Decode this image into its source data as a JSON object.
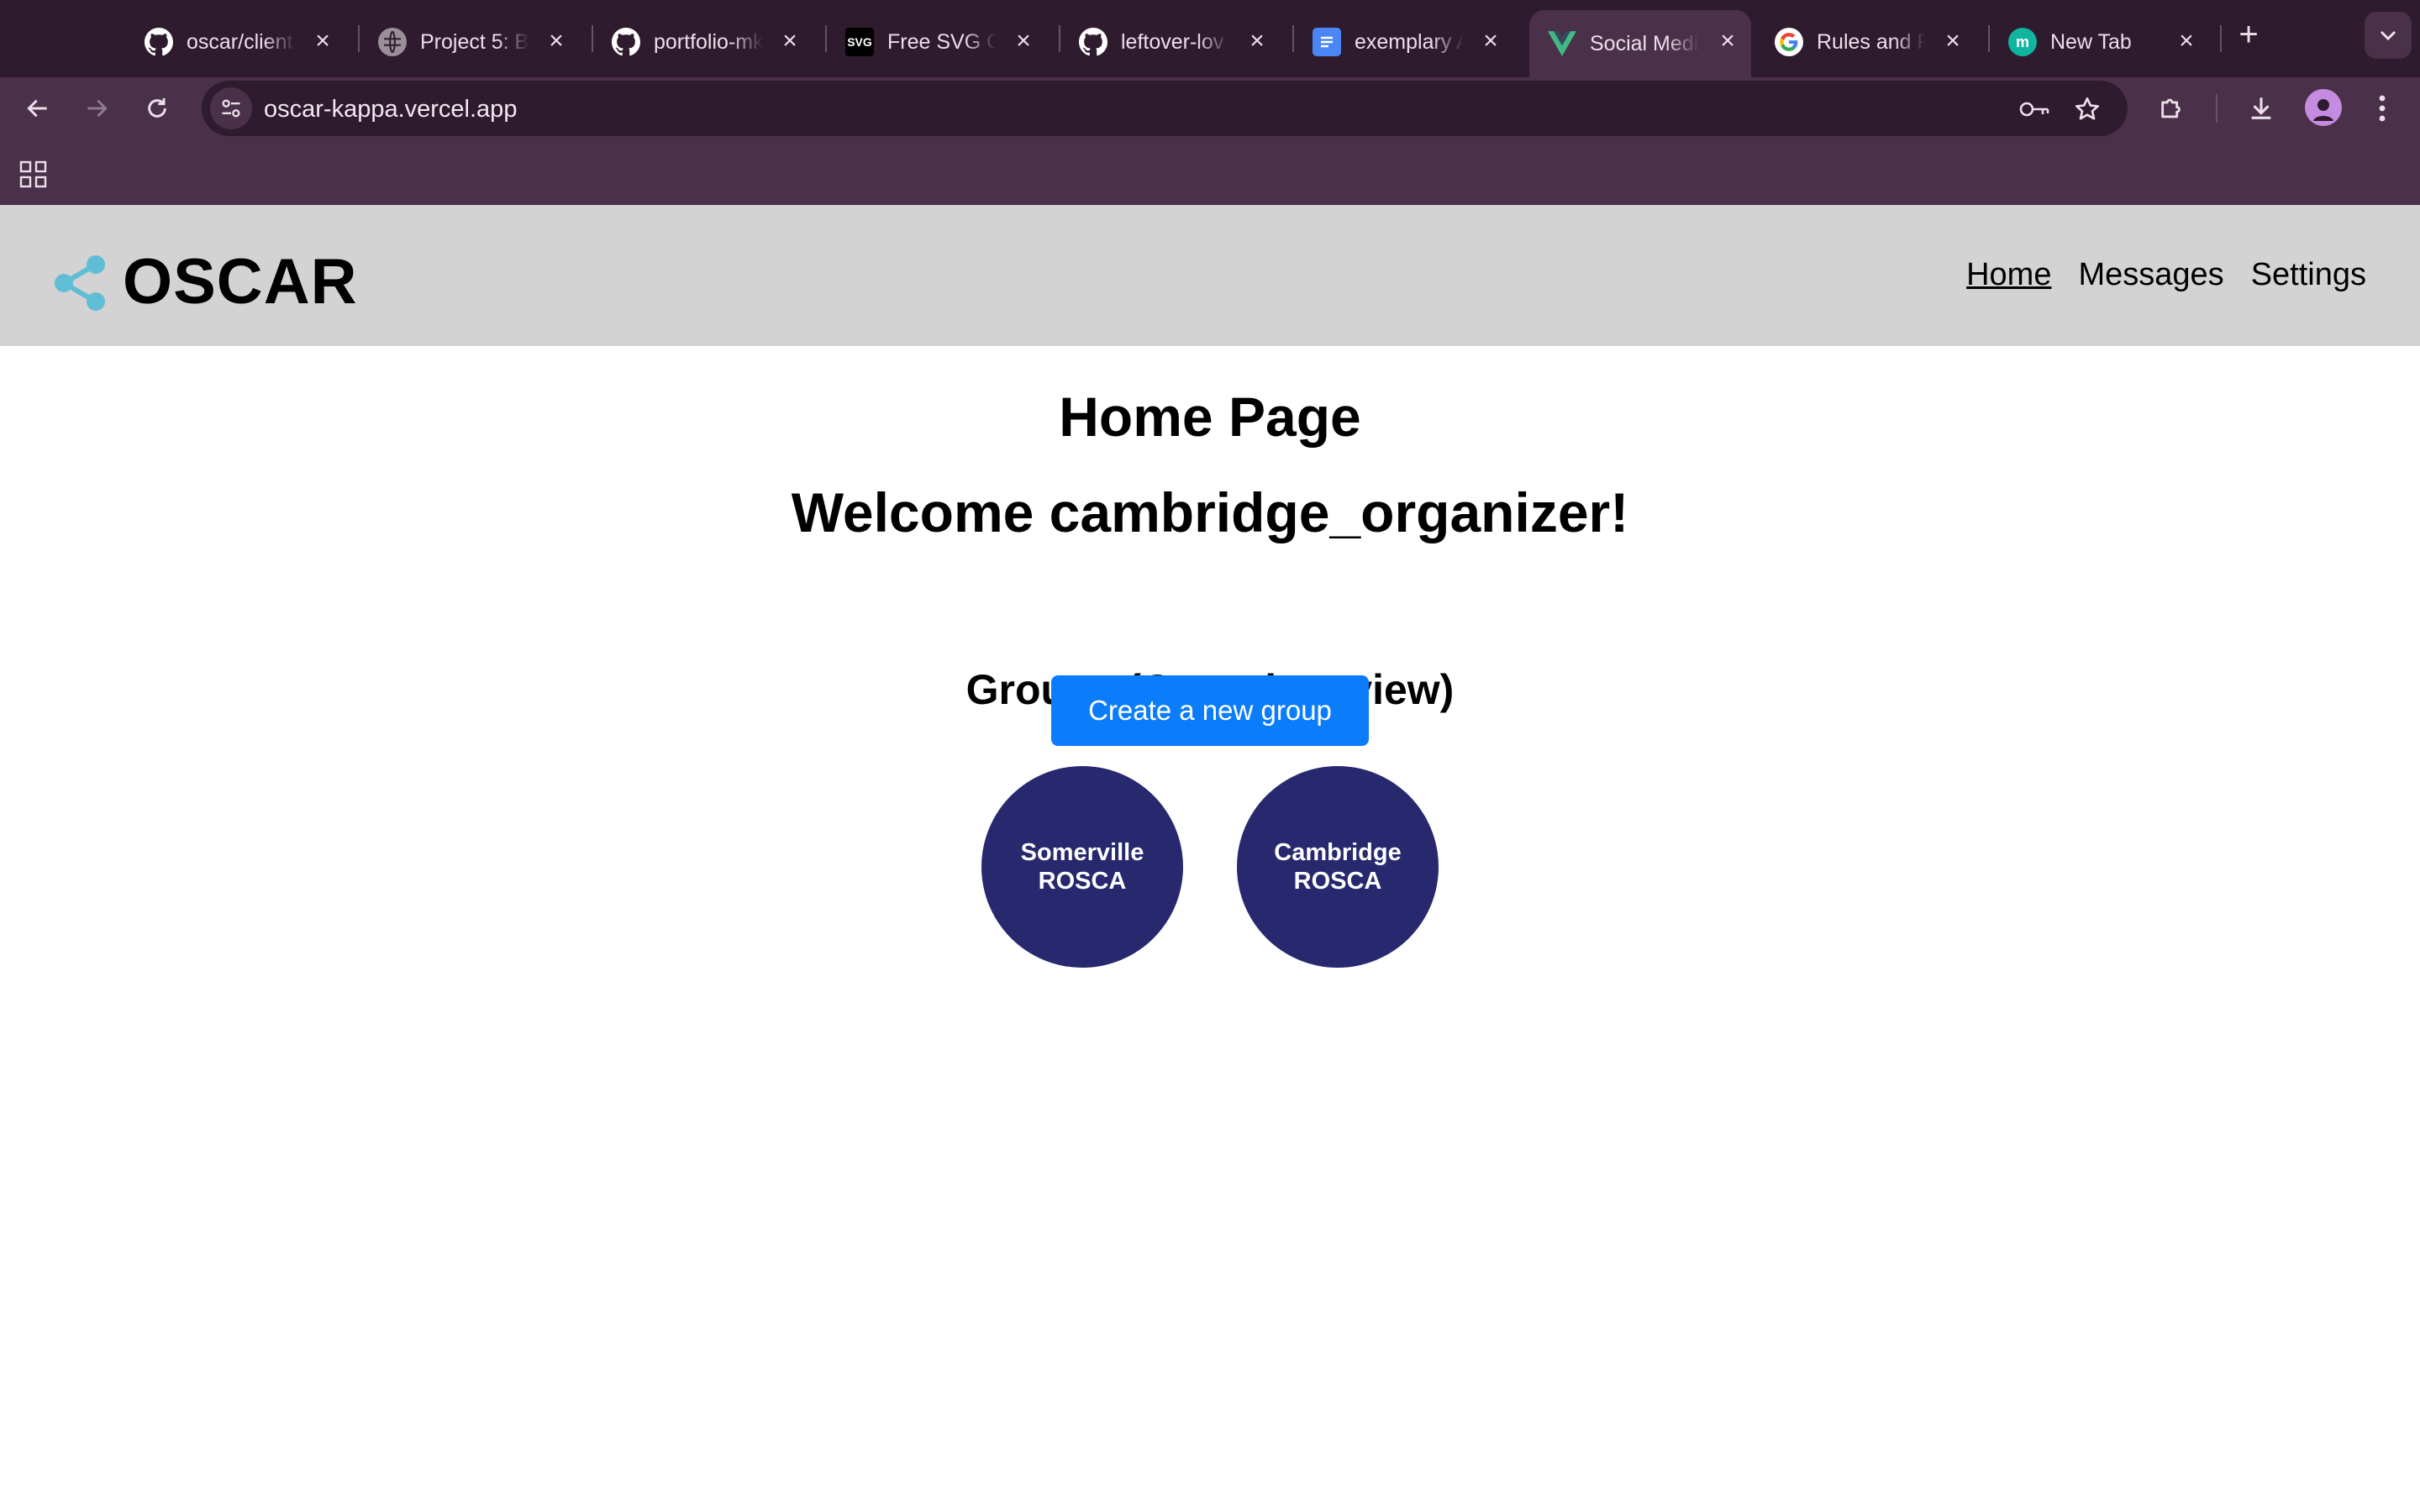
{
  "browser": {
    "tabs": [
      {
        "title": "oscar/client",
        "icon": "github-icon",
        "active": false
      },
      {
        "title": "Project 5: Bu",
        "icon": "globe-icon",
        "active": false
      },
      {
        "title": "portfolio-mk",
        "icon": "github-icon",
        "active": false
      },
      {
        "title": "Free SVG Co",
        "icon": "svg-icon",
        "active": false
      },
      {
        "title": "leftover-lov",
        "icon": "github-icon",
        "active": false
      },
      {
        "title": "exemplary A",
        "icon": "docs-icon",
        "active": false
      },
      {
        "title": "Social Medi",
        "icon": "vue-icon",
        "active": true
      },
      {
        "title": "Rules and R",
        "icon": "google-icon",
        "active": false
      },
      {
        "title": "New Tab",
        "icon": "m-icon",
        "active": false
      }
    ],
    "url": "oscar-kappa.vercel.app"
  },
  "site": {
    "brand": "OSCAR",
    "nav": [
      {
        "label": "Home",
        "current": true
      },
      {
        "label": "Messages",
        "current": false
      },
      {
        "label": "Settings",
        "current": false
      }
    ]
  },
  "page": {
    "title": "Home Page",
    "welcome": "Welcome cambridge_organizer!",
    "groups_heading": "Groups (Organizer view)",
    "groups": [
      {
        "name": "Somerville ROSCA"
      },
      {
        "name": "Cambridge ROSCA"
      }
    ],
    "create_button": "Create a new group"
  },
  "colors": {
    "chrome_dark": "#2e1b2d",
    "chrome_light": "#4a3048",
    "header_bg": "#d3d3d3",
    "group_circle": "#27286e",
    "primary_button": "#0b7dfb",
    "logo_accent": "#5fbdd6"
  }
}
